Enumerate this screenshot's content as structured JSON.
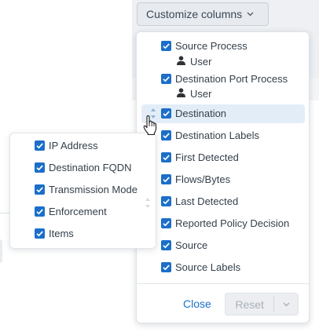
{
  "toolbar": {
    "customize_label": "Customize columns",
    "chevron_icon": "chevron-down-icon"
  },
  "column_menu": {
    "items": [
      {
        "label": "Source Process",
        "checked": true,
        "sub_label": "User"
      },
      {
        "label": "Destination Port Process",
        "checked": true,
        "sub_label": "User"
      },
      {
        "label": "Destination",
        "checked": true,
        "highlighted": true
      },
      {
        "label": "Destination Labels",
        "checked": true
      },
      {
        "label": "First Detected",
        "checked": true
      },
      {
        "label": "Flows/Bytes",
        "checked": true
      },
      {
        "label": "Last Detected",
        "checked": true
      },
      {
        "label": "Reported Policy Decision",
        "checked": true
      },
      {
        "label": "Source",
        "checked": true
      },
      {
        "label": "Source Labels",
        "checked": true
      }
    ],
    "close_label": "Close",
    "reset_label": "Reset"
  },
  "sub_menu": {
    "items": [
      {
        "label": "IP Address",
        "checked": true
      },
      {
        "label": "Destination FQDN",
        "checked": true
      },
      {
        "label": "Transmission Mode",
        "checked": true
      },
      {
        "label": "Enforcement",
        "checked": true
      },
      {
        "label": "Items",
        "checked": true
      }
    ]
  },
  "colors": {
    "accent": "#1b6fc9",
    "highlight": "#e3edf8",
    "button_bg": "#e7eaee"
  }
}
